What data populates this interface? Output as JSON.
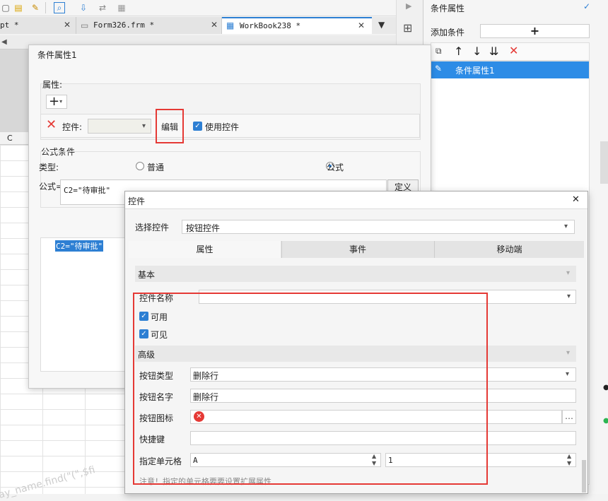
{
  "tabs": [
    {
      "label": "pt *"
    },
    {
      "label": "Form326.frm *"
    },
    {
      "label": "WorkBook238 *"
    }
  ],
  "grid": {
    "col_c": "C"
  },
  "right_panel": {
    "title": "条件属性",
    "add_label": "添加条件",
    "add_symbol": "+",
    "item": "条件属性1"
  },
  "dialog1": {
    "title": "条件属性1",
    "section_props": "属性:",
    "add_symbol": "+",
    "control_label": "控件:",
    "edit_label": "编辑",
    "use_control": "使用控件",
    "formula_cond": "公式条件",
    "type_label": "类型:",
    "type_normal": "普通",
    "type_formula": "公式",
    "formula_label": "公式=",
    "formula_value": "C2=\"待审批\"",
    "define_label": "定义",
    "list_item": "C2=\"待审批\""
  },
  "dialog2": {
    "title": "控件",
    "close": "✕",
    "select_label": "选择控件",
    "select_value": "按钮控件",
    "tabs": [
      "属性",
      "事件",
      "移动端"
    ],
    "basic": "基本",
    "name_label": "控件名称",
    "enabled": "可用",
    "visible": "可见",
    "advanced": "高级",
    "btn_type_label": "按钮类型",
    "btn_type_value": "删除行",
    "btn_name_label": "按钮名字",
    "btn_name_value": "删除行",
    "btn_icon_label": "按钮图标",
    "shortcut_label": "快捷键",
    "cell_label": "指定单元格",
    "cell_col": "A",
    "cell_row": "1",
    "note": "注意！指定的单元格要要设置扩展属性"
  },
  "watermark": "ay_name.find(\"(\",$fi"
}
